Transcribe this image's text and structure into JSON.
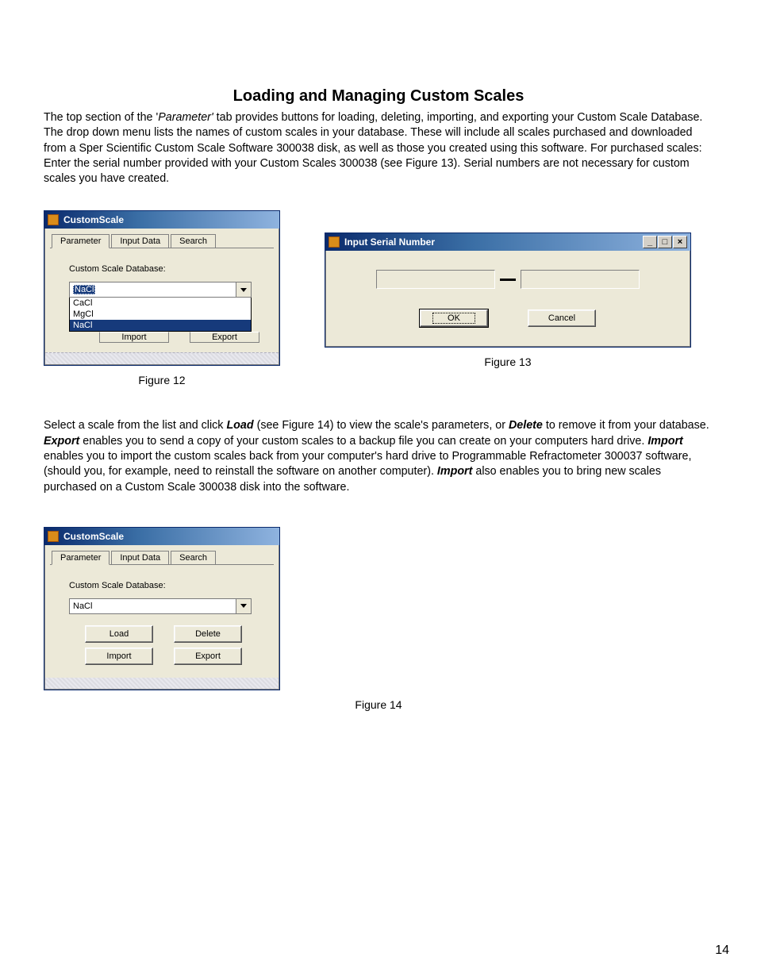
{
  "heading": "Loading and Managing Custom Scales",
  "para1_pre": "The top section of the '",
  "para1_em": "Parameter'",
  "para1_post": " tab provides buttons for loading, deleting, importing, and exporting your Custom Scale Database.  The drop down menu lists the names of custom scales in your database.  These will include all scales purchased and downloaded from a Sper Scientific Custom Scale Software 300038 disk, as well as those you created using this software.  For purchased scales: Enter the serial number provided with your Custom Scales 300038 (see Figure 13). Serial numbers are not necessary for custom scales you have created.",
  "para2_a": "Select a scale from the list and click ",
  "para2_load": "Load",
  "para2_b": " (see Figure 14) to view the scale's parameters, or ",
  "para2_delete": "Delete",
  "para2_c": " to remove it from your database.  ",
  "para2_export": "Export",
  "para2_d": " enables you to send a copy of your custom scales to a backup file you can create on your computers hard drive.  ",
  "para2_import": "Import",
  "para2_e": " enables you to import the custom scales back from your computer's hard drive to Programmable Refractometer 300037 software, (should you, for example, need to reinstall the software on another computer).  ",
  "para2_import2": "Import",
  "para2_f": " also enables you to bring new scales purchased on a Custom Scale 300038 disk into the software.",
  "fig12": {
    "caption": "Figure 12",
    "title": "CustomScale",
    "tabs": {
      "parameter": "Parameter",
      "input": "Input Data",
      "search": "Search"
    },
    "label": "Custom Scale Database:",
    "selected": "NaCl",
    "options": [
      "CaCl",
      "MgCl",
      "NaCl"
    ],
    "import": "Import",
    "export": "Export"
  },
  "fig13": {
    "caption": "Figure 13",
    "title": "Input Serial Number",
    "ok": "OK",
    "cancel": "Cancel"
  },
  "fig14": {
    "caption": "Figure 14",
    "title": "CustomScale",
    "tabs": {
      "parameter": "Parameter",
      "input": "Input Data",
      "search": "Search"
    },
    "label": "Custom Scale Database:",
    "selected": "NaCl",
    "load": "Load",
    "delete": "Delete",
    "import": "Import",
    "export": "Export"
  },
  "page_number": "14"
}
